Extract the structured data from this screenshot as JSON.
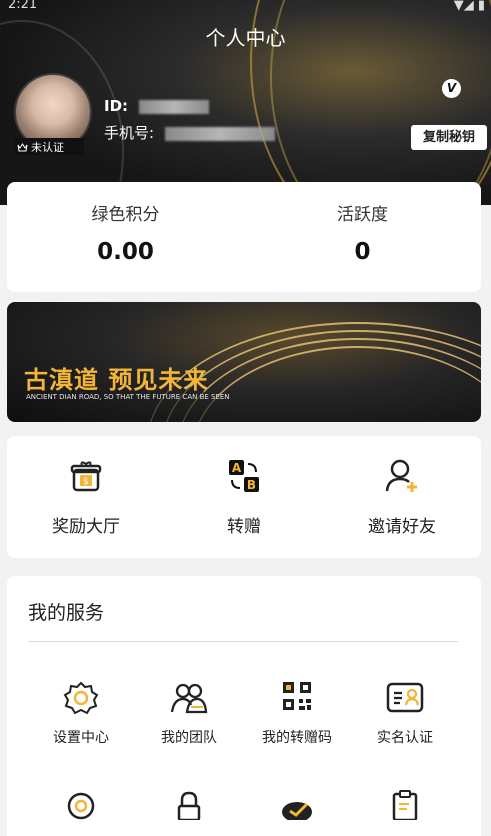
{
  "status": {
    "time": "2:21",
    "icons": "signal-wifi-battery"
  },
  "header": {
    "title": "个人中心"
  },
  "profile": {
    "unverified_label": "未认证",
    "id_label": "ID:",
    "phone_label": "手机号:",
    "copy_key_label": "复制秘钥"
  },
  "stats": [
    {
      "label": "绿色积分",
      "value": "0.00"
    },
    {
      "label": "活跃度",
      "value": "0"
    }
  ],
  "banner": {
    "title": "古滇道 预见未来",
    "subtitle": "ANCIENT DIAN ROAD, SO THAT THE FUTURE CAN BE SEEN"
  },
  "actions": [
    {
      "label": "奖励大厅",
      "icon": "gift-box-icon"
    },
    {
      "label": "转赠",
      "icon": "transfer-ab-icon"
    },
    {
      "label": "邀请好友",
      "icon": "add-user-icon"
    }
  ],
  "services": {
    "title": "我的服务",
    "items": [
      {
        "label": "设置中心",
        "icon": "gear-icon"
      },
      {
        "label": "我的团队",
        "icon": "team-icon"
      },
      {
        "label": "我的转赠码",
        "icon": "qr-code-icon"
      },
      {
        "label": "实名认证",
        "icon": "id-card-icon"
      }
    ]
  },
  "colors": {
    "accent": "#f2b535",
    "header_bg": "#1a1a1a",
    "page_bg": "#f2f2f2"
  }
}
